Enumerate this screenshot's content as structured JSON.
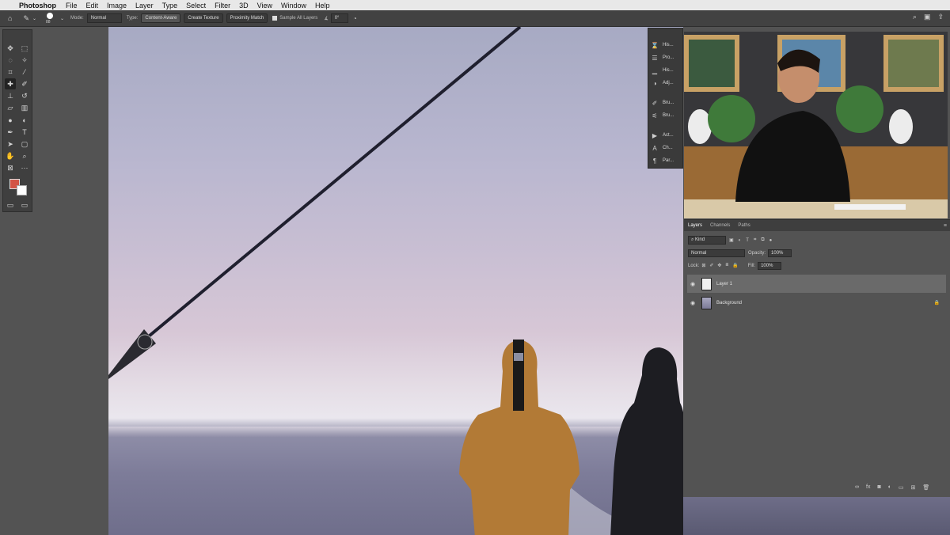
{
  "menubar": {
    "apple": "",
    "app_name": "Photoshop",
    "items": [
      "File",
      "Edit",
      "Image",
      "Layer",
      "Type",
      "Select",
      "Filter",
      "3D",
      "View",
      "Window",
      "Help"
    ]
  },
  "options": {
    "brush_size": "88",
    "mode_label": "Mode:",
    "mode_value": "Normal",
    "type_label": "Type:",
    "type_buttons": [
      "Content-Aware",
      "Create Texture",
      "Proximity Match"
    ],
    "sample_all_layers": "Sample All Layers",
    "angle_value": "0°"
  },
  "panel_strip": {
    "items": [
      "His...",
      "Pro...",
      "His...",
      "Adj...",
      "Bru...",
      "Bru...",
      "Act...",
      "Ch...",
      "Par..."
    ]
  },
  "layers_panel": {
    "tabs": [
      "Layers",
      "Channels",
      "Paths"
    ],
    "kind_label": "Kind",
    "blend_mode": "Normal",
    "opacity_label": "Opacity:",
    "opacity_value": "100%",
    "lock_label": "Lock:",
    "fill_label": "Fill:",
    "fill_value": "100%",
    "layers": [
      {
        "name": "Layer 1",
        "selected": true
      },
      {
        "name": "Background",
        "selected": false
      }
    ]
  },
  "colors": {
    "foreground": "#d35445",
    "background": "#ffffff"
  }
}
